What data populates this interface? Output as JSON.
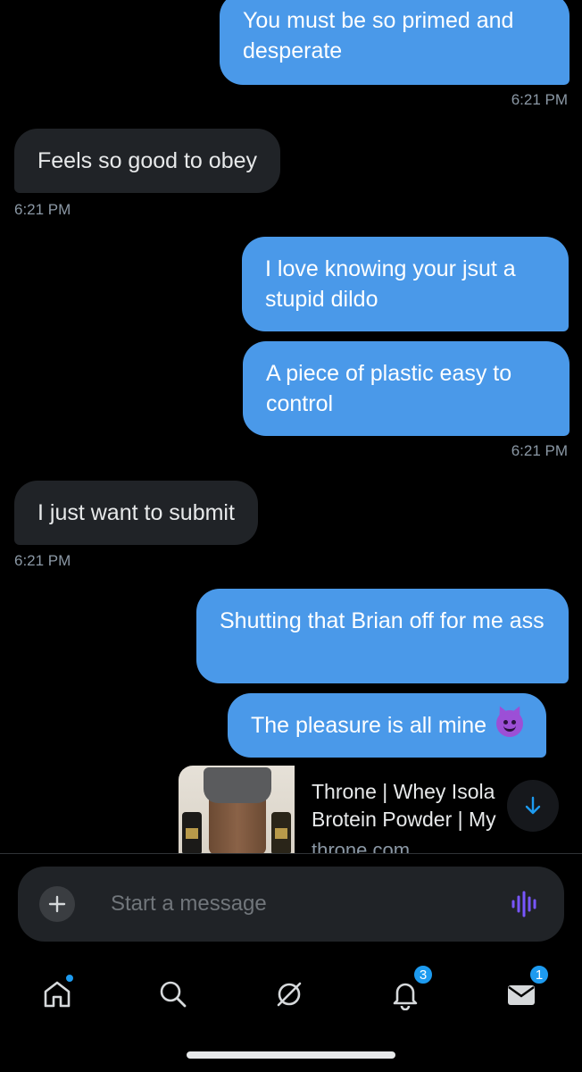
{
  "messages": [
    {
      "text": "You must be so primed and desperate"
    },
    {
      "text": "6:21 PM"
    },
    {
      "text": "Feels so good to obey"
    },
    {
      "text": "6:21 PM"
    },
    {
      "text": "I love knowing your jsut a stupid dildo"
    },
    {
      "text": "A piece of plastic easy to control"
    },
    {
      "text": "6:21 PM"
    },
    {
      "text": "I just want to submit"
    },
    {
      "text": "6:21 PM"
    },
    {
      "text": "Shutting that Brian off for me ass"
    },
    {
      "text": "The pleasure is all mine"
    }
  ],
  "emoji": "smiling-face-with-horns",
  "link_card": {
    "title_line1": "Throne | Whey Isola",
    "title_line2": "Brotein Powder | My",
    "domain": "throne.com"
  },
  "composer": {
    "placeholder": "Start a message"
  },
  "tabbar": {
    "notifications_badge": "3",
    "messages_badge": "1"
  },
  "colors": {
    "sent_bubble": "#4a99e9",
    "received_bubble": "#202327",
    "accent": "#1d9bf0",
    "voice_icon": "#7856ff"
  }
}
